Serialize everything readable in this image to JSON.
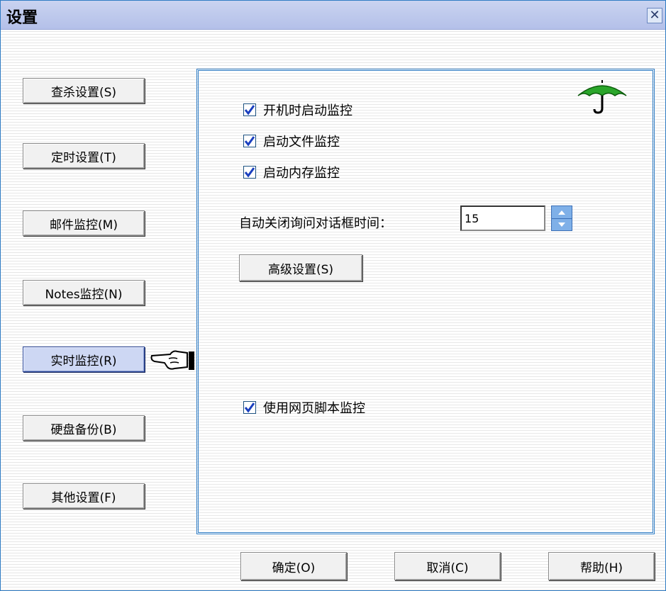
{
  "window": {
    "title": "设置",
    "close_label": "✕"
  },
  "sidebar": {
    "items": [
      {
        "label": "查杀设置(S)",
        "active": false
      },
      {
        "label": "定时设置(T)",
        "active": false
      },
      {
        "label": "邮件监控(M)",
        "active": false
      },
      {
        "label": "Notes监控(N)",
        "active": false
      },
      {
        "label": "实时监控(R)",
        "active": true
      },
      {
        "label": "硬盘备份(B)",
        "active": false
      },
      {
        "label": "其他设置(F)",
        "active": false
      }
    ],
    "selected_pointer_icon": "hand-pointer-icon"
  },
  "panel": {
    "corner_icon": "umbrella-icon",
    "options": [
      {
        "label": "开机时启动监控",
        "checked": true
      },
      {
        "label": "启动文件监控",
        "checked": true
      },
      {
        "label": "启动内存监控",
        "checked": true
      }
    ],
    "auto_close": {
      "label": "自动关闭询问对话框时间：",
      "value": "15"
    },
    "advanced_button": "高级设置(S)",
    "script_option": {
      "label": "使用网页脚本监控",
      "checked": true
    }
  },
  "footer": {
    "ok": "确定(O)",
    "cancel": "取消(C)",
    "help": "帮助(H)"
  },
  "colors": {
    "frame": "#2f7cc4",
    "titlebar": "#b4c0e9",
    "active_button": "#cdd7f3",
    "umbrella_green": "#2aa52a",
    "check_mark": "#1a3fbf"
  }
}
